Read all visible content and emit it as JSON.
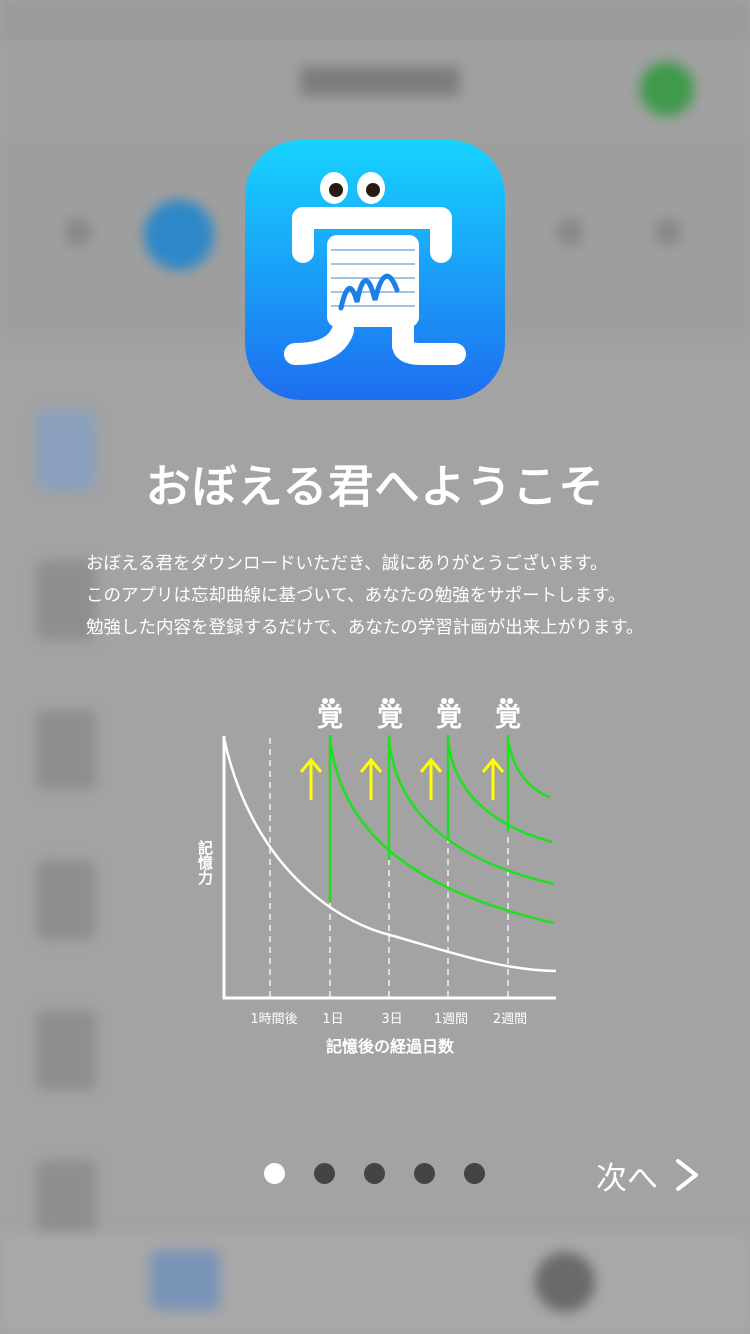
{
  "welcome": {
    "title": "おぼえる君へようこそ",
    "intro_lines": [
      "おぼえる君をダウンロードいただき、誠にありがとうございます。",
      "このアプリは忘却曲線に基づいて、あなたの勉強をサポートします。",
      "勉強した内容を登録するだけで、あなたの学習計画が出来上がります。"
    ]
  },
  "app_icon": {
    "glyph": "覚",
    "gradient_top": "#17d3ff",
    "gradient_bottom": "#1e6ef0"
  },
  "diagram": {
    "review_glyph": "覚",
    "y_label": "記憶力",
    "x_ticks": [
      "1時間後",
      "1日",
      "3日",
      "1週間",
      "2週間"
    ],
    "x_label": "記憶後の経過日数",
    "colors": {
      "base_curve": "#ffffff",
      "review_curves": "#1fe01f",
      "arrows": "#ffff00"
    }
  },
  "pager": {
    "count": 5,
    "active_index": 0
  },
  "next_button": {
    "label": "次へ"
  }
}
